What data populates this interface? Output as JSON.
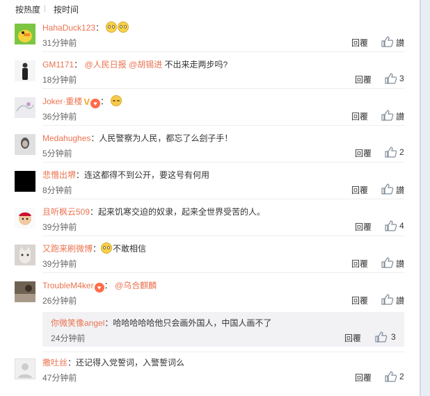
{
  "sort": {
    "by_heat": "按热度",
    "by_time": "按时间"
  },
  "reply_label": "回覆",
  "colors": {
    "username": "#eb7350",
    "accent_like": "#7f8c99"
  },
  "comments": [
    {
      "user": "HahaDuck123",
      "text": "",
      "time": "31分钟前",
      "likes": "讃"
    },
    {
      "user": "GM1171",
      "mention1": "@人民日报",
      "mention2": "@胡锡进",
      "text": " 不出来走两步吗?",
      "time": "18分钟前",
      "likes": "3"
    },
    {
      "user": "Joker·重楼",
      "text": "",
      "time": "36分钟前",
      "likes": "讃"
    },
    {
      "user": "Medahughes",
      "text": "人民警察为人民，都忘了么刽子手！",
      "time": "5分钟前",
      "likes": "2"
    },
    {
      "user": "悲憯出堺",
      "text": "连这都得不到公开，要这号有何用",
      "time": "8分钟前",
      "likes": "讃"
    },
    {
      "user": "且听枫云509",
      "text": "起来饥寒交迫的奴隶，起来全世界受苦的人。",
      "time": "39分钟前",
      "likes": "4"
    },
    {
      "user": "又跑来刷微博",
      "text": "不敢相信",
      "time": "39分钟前",
      "likes": "讃"
    },
    {
      "user": "TroubleM4ker",
      "mention1": "@乌合麒麟",
      "text": "",
      "time": "26分钟前",
      "likes": "讃"
    },
    {
      "user": "撒吐丝",
      "text": "还记得入党誓词，入警誓词么",
      "time": "47分钟前",
      "likes": "2"
    }
  ],
  "subreply": {
    "user": "你微笑像angel",
    "text": "哈哈哈哈哈他只会画外国人，中国人画不了",
    "time": "24分钟前",
    "likes": "3"
  }
}
